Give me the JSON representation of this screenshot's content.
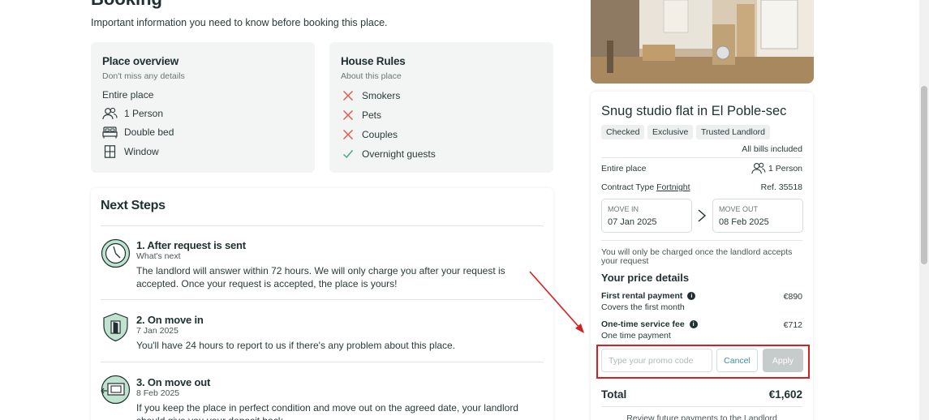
{
  "header": {
    "title_partial": "Booking",
    "intro": "Important information you need to know before booking this place."
  },
  "overview": {
    "title": "Place overview",
    "subtitle": "Don't miss any details",
    "type": "Entire place",
    "people": "1 Person",
    "bed": "Double bed",
    "window": "Window"
  },
  "rules": {
    "title": "House Rules",
    "subtitle": "About this place",
    "items": [
      {
        "label": "Smokers",
        "allowed": false
      },
      {
        "label": "Pets",
        "allowed": false
      },
      {
        "label": "Couples",
        "allowed": false
      },
      {
        "label": "Overnight guests",
        "allowed": true
      }
    ]
  },
  "steps": {
    "title": "Next Steps",
    "items": [
      {
        "title": "1. After request is sent",
        "sub": "What's next",
        "text": "The landlord will answer within 72 hours. We will only charge you after your request is accepted. Once your request is accepted, the place is yours!"
      },
      {
        "title": "2. On move in",
        "sub": "7 Jan 2025",
        "text": "You'll have 24 hours to report to us if there's any problem about this place."
      },
      {
        "title": "3. On move out",
        "sub": "8 Feb 2025",
        "text": "If you keep the place in perfect condition and move out on the agreed date, your landlord should give you your deposit back."
      }
    ]
  },
  "listing": {
    "title": "Snug studio flat in El Poble-sec",
    "tags": [
      "Checked",
      "Exclusive",
      "Trusted Landlord"
    ],
    "bills": "All bills included",
    "type": "Entire place",
    "people": "1 Person",
    "contract_label": "Contract Type",
    "contract_value": "Fortnight",
    "ref": "Ref. 35518",
    "move_in_label": "MOVE IN",
    "move_in_date": "07 Jan 2025",
    "move_out_label": "MOVE OUT",
    "move_out_date": "08 Feb 2025",
    "charge_note": "You will only be charged once the landlord accepts your request"
  },
  "price": {
    "title": "Your price details",
    "first_label": "First rental payment",
    "first_sub": "Covers the first month",
    "first_value": "€890",
    "fee_label": "One-time service fee",
    "fee_sub": "One time payment",
    "fee_value": "€712",
    "promo_placeholder": "Type your promo code",
    "cancel_label": "Cancel",
    "apply_label": "Apply",
    "total_label": "Total",
    "total_value": "€1,602",
    "review_link": "Review future payments to the Landlord"
  },
  "colors": {
    "accent": "#3d8fa0",
    "cross": "#e2574c",
    "check": "#3ea87a",
    "highlight": "#d42020"
  }
}
